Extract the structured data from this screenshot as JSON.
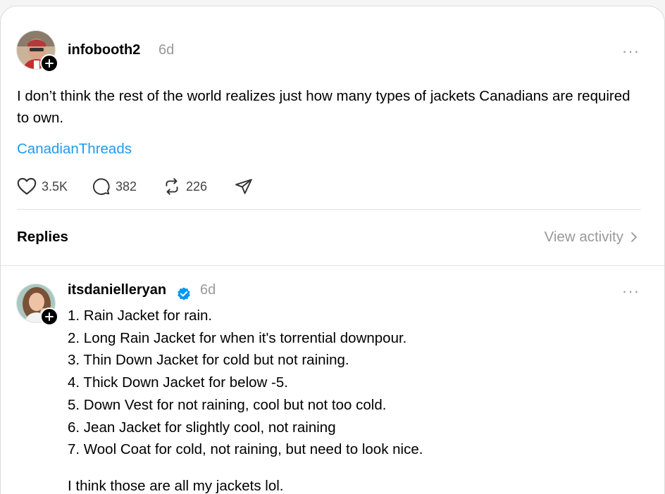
{
  "post": {
    "username": "infobooth2",
    "time": "6d",
    "more": "···",
    "text": "I don’t think the rest of the world realizes just how many types of jackets Canadians are required to own.",
    "tag": "CanadianThreads",
    "likes": "3.5K",
    "comments": "382",
    "reposts": "226"
  },
  "replies_header": {
    "label": "Replies",
    "view_activity": "View activity"
  },
  "reply": {
    "username": "itsdanielleryan",
    "time": "6d",
    "more": "···",
    "items": [
      "1. Rain Jacket for rain.",
      "2. Long Rain Jacket for when it's torrential downpour.",
      "3. Thin Down Jacket for cold but not raining.",
      "4. Thick Down Jacket for below -5.",
      "5. Down Vest for not raining, cool but not too cold.",
      "6. Jean Jacket for slightly cool, not raining",
      "7. Wool Coat for cold, not raining, but need to look nice."
    ],
    "footer": "I think those are all my jackets lol."
  },
  "colors": {
    "tag": "#1d9bf0",
    "muted": "#999999",
    "verified": "#0095f6"
  },
  "icons": [
    "plus-icon",
    "heart-icon",
    "comment-icon",
    "repost-icon",
    "share-icon",
    "chevron-right-icon",
    "verified-icon"
  ]
}
